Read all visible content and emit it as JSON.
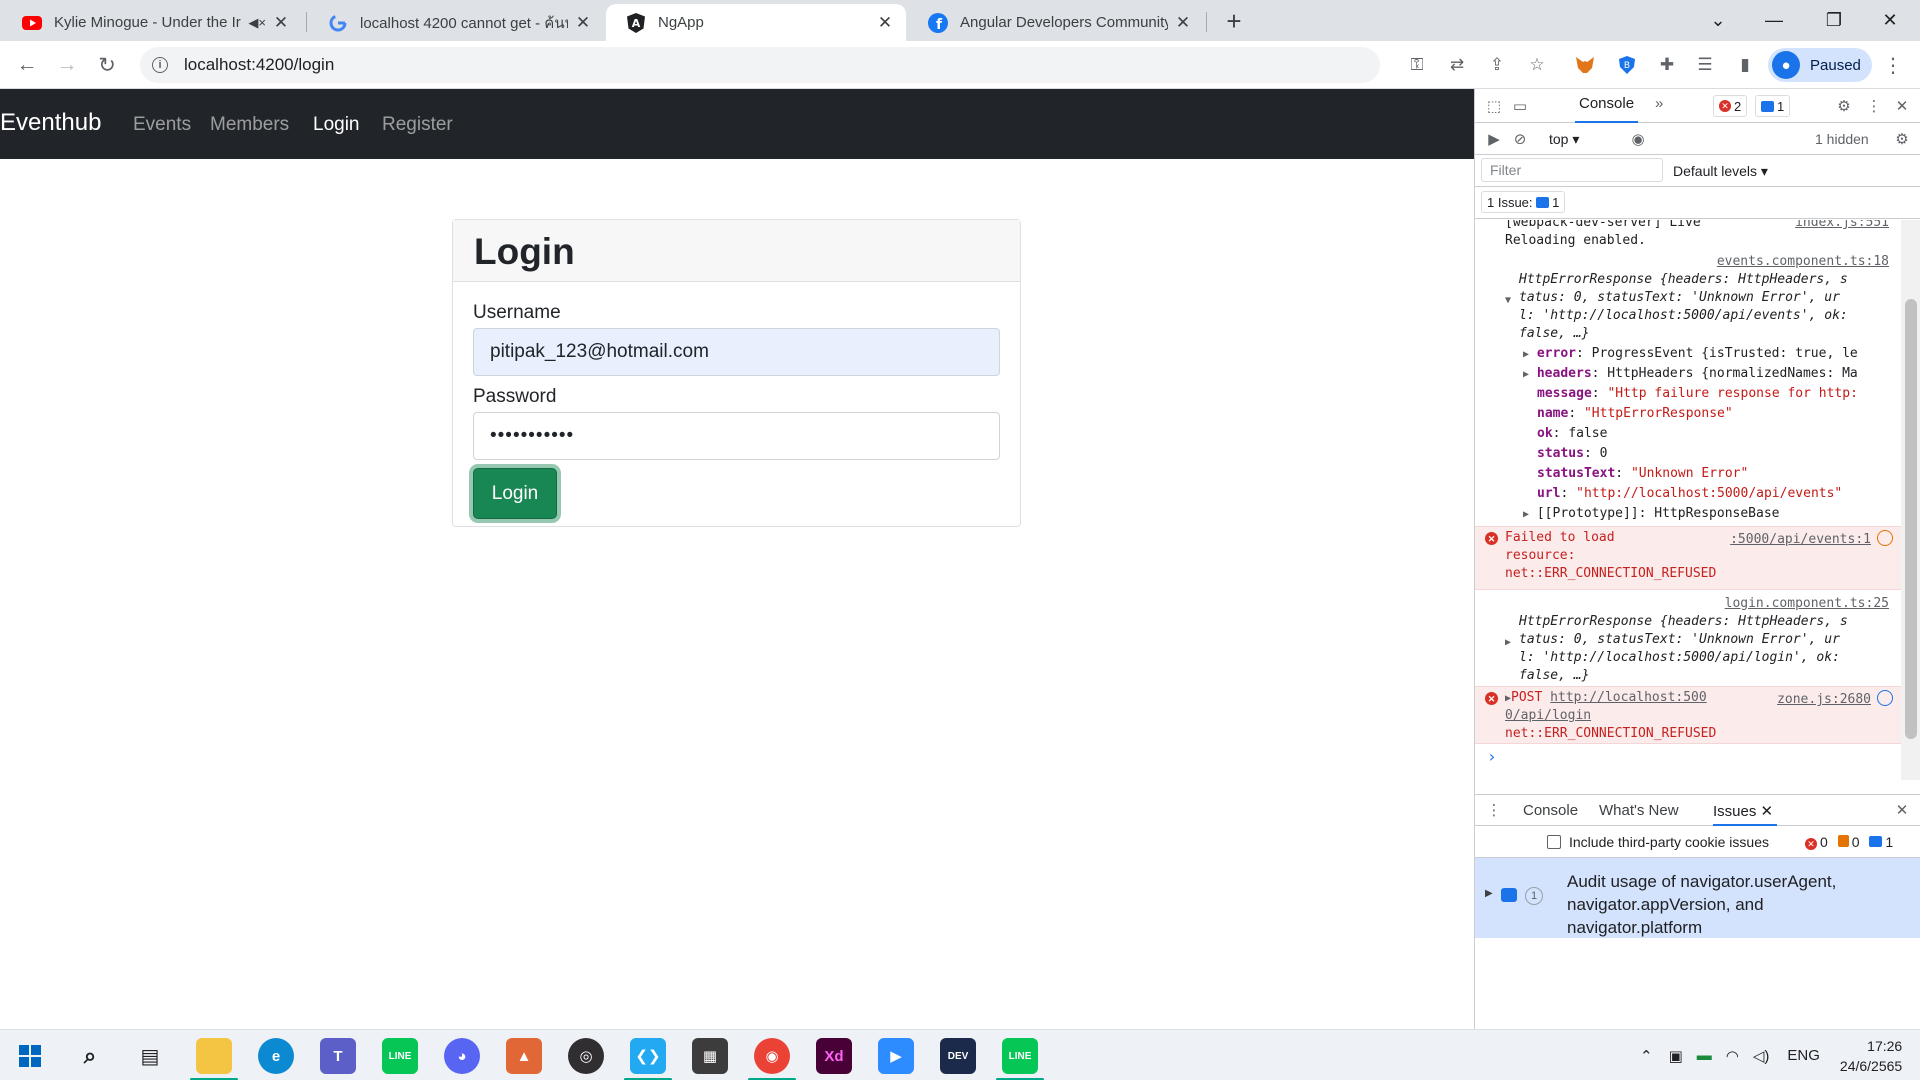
{
  "tabs": [
    {
      "title": "Kylie Minogue - Under the Ir",
      "icon": "youtube-icon",
      "color": "#ff0000"
    },
    {
      "title": "localhost 4200 cannot get - ค้นห",
      "icon": "google-icon",
      "color": "#4285f4"
    },
    {
      "title": "NgApp",
      "icon": "angular-icon",
      "color": "#202124"
    },
    {
      "title": "Angular Developers Community |",
      "icon": "facebook-icon",
      "color": "#1877f2"
    }
  ],
  "toolbar": {
    "url": "localhost:4200/login",
    "profile_label": "Paused"
  },
  "app": {
    "brand": "Eventhub",
    "nav": [
      "Events",
      "Members",
      "Login",
      "Register"
    ],
    "active_nav": "Login",
    "login": {
      "title": "Login",
      "username_label": "Username",
      "username_value": "pitipak_123@hotmail.com",
      "password_label": "Password",
      "password_value": "•••••••••••",
      "submit_label": "Login"
    },
    "colors": {
      "navbar": "#212529",
      "success": "#198754"
    }
  },
  "devtools": {
    "tabs": {
      "console": "Console",
      "more": "»"
    },
    "error_count": "2",
    "message_count": "1",
    "context": "top",
    "hidden": "1 hidden",
    "filter_placeholder": "Filter",
    "levels": "Default levels",
    "issues_badge_label": "1 Issue:",
    "issues_badge_count": "1",
    "console_lines": {
      "reload_1": "[webpack-dev-server] Live",
      "reload_1_src": "index.js:551",
      "reload_2": "Reloading enabled.",
      "ev_src": "events.component.ts:18",
      "ev_1": "HttpErrorResponse {headers: HttpHeaders, s",
      "ev_2": "tatus: 0, statusText: 'Unknown Error', ur",
      "ev_3": "l: 'http://localhost:5000/api/events', ok:",
      "ev_4": "false, …}",
      "p_error_key": "error",
      "p_error_val": ": ProgressEvent {isTrusted: true, le",
      "p_headers_key": "headers",
      "p_headers_val": ": HttpHeaders {normalizedNames: Ma",
      "p_message_key": "message",
      "p_message_val": "\"Http failure response for http:",
      "p_name_key": "name",
      "p_name_val": "\"HttpErrorResponse\"",
      "p_ok_key": "ok",
      "p_ok_val": "false",
      "p_status_key": "status",
      "p_status_val": "0",
      "p_statustext_key": "statusText",
      "p_statustext_val": "\"Unknown Error\"",
      "p_url_key": "url",
      "p_url_val": "\"http://localhost:5000/api/events\"",
      "p_proto": "[[Prototype]]: HttpResponseBase",
      "err1_1": "Failed to load",
      "err1_2": "resource:",
      "err1_3": "net::ERR_CONNECTION_REFUSED",
      "err1_src": ":5000/api/events:1",
      "lg_src": "login.component.ts:25",
      "lg_1": "HttpErrorResponse {headers: HttpHeaders, s",
      "lg_2": "tatus: 0, statusText: 'Unknown Error', ur",
      "lg_3": "l: 'http://localhost:5000/api/login', ok:",
      "lg_4": "false, …}",
      "err2_method": "POST ",
      "err2_url_1": "http://localhost:500",
      "err2_url_2": "0/api/login",
      "err2_3": "net::ERR_CONNECTION_REFUSED",
      "err2_src": "zone.js:2680",
      "prompt": "›"
    },
    "drawer": {
      "tab_console": "Console",
      "tab_whats_new": "What's New",
      "tab_issues": "Issues",
      "third_party": "Include third-party cookie issues",
      "count_errors": "0",
      "count_warnings": "0",
      "count_info": "1",
      "issue_count": "1",
      "issue_text_1": "Audit usage of navigator.userAgent,",
      "issue_text_2": "navigator.appVersion, and",
      "issue_text_3": "navigator.platform"
    }
  },
  "taskbar": {
    "language": "ENG",
    "time": "17:26",
    "date": "24/6/2565"
  }
}
